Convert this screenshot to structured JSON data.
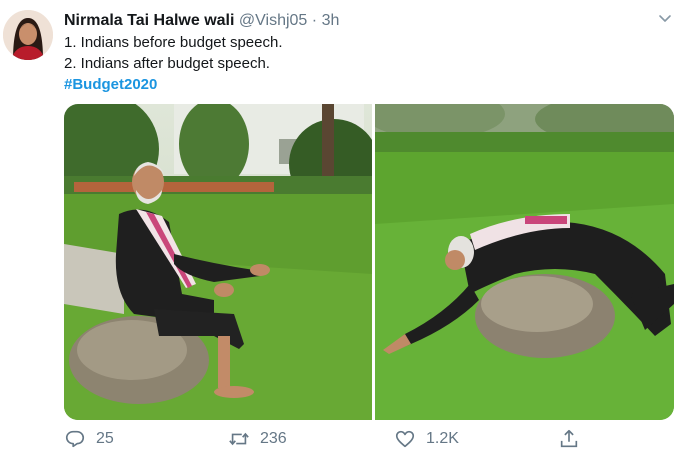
{
  "tweet": {
    "author_name": "Nirmala Tai Halwe wali",
    "handle": "@Vishj05",
    "separator": "·",
    "time": "3h",
    "text_lines": [
      "1. Indians before budget speech.",
      "2. Indians after budget speech."
    ],
    "hashtag": "#Budget2020"
  },
  "actions": {
    "reply_count": "25",
    "retweet_count": "236",
    "like_count": "1.2K"
  },
  "icons": {
    "reply": "speech-bubble-icon",
    "retweet": "retweet-arrows-icon",
    "like": "heart-icon",
    "share": "share-upload-icon",
    "more": "chevron-down-icon"
  },
  "colors": {
    "link": "#1b95e0",
    "secondary_text": "#657786",
    "primary_text": "#14171a"
  }
}
